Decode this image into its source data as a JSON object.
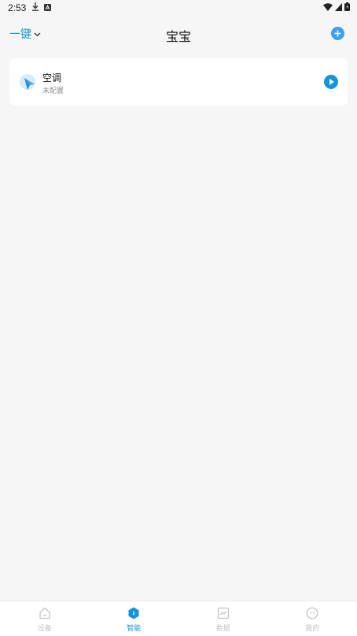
{
  "status_bar": {
    "time": "2:53"
  },
  "header": {
    "scene_switch_label": "一键",
    "title": "宝宝"
  },
  "scenes": [
    {
      "name": "空调",
      "status": "未配置"
    }
  ],
  "bottom_nav": {
    "items": [
      {
        "label": "设备",
        "icon": "home-icon",
        "active": false
      },
      {
        "label": "智能",
        "icon": "smart-hexagon-icon",
        "active": true
      },
      {
        "label": "数据",
        "icon": "chart-icon",
        "active": false
      },
      {
        "label": "我的",
        "icon": "profile-icon",
        "active": false
      }
    ]
  },
  "colors": {
    "accent": "#1296db",
    "add_button": "#3aa0f5",
    "background": "#f6f6f6",
    "inactive_nav": "#c2c2c2"
  }
}
